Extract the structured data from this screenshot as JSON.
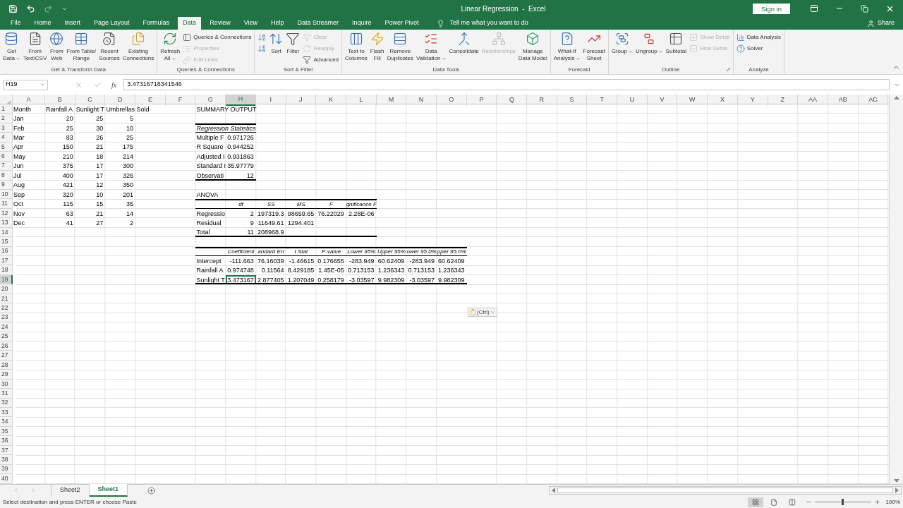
{
  "window": {
    "title": "Linear Regression  -  Excel",
    "sign_in": "Sign in"
  },
  "quick_access": [
    {
      "kind": "save",
      "disabled": false
    },
    {
      "kind": "undo",
      "disabled": false
    },
    {
      "kind": "redo",
      "disabled": true
    },
    {
      "kind": "customize",
      "disabled": false
    }
  ],
  "tabs": [
    {
      "label": "File",
      "selected": false
    },
    {
      "label": "Home",
      "selected": false
    },
    {
      "label": "Insert",
      "selected": false
    },
    {
      "label": "Page Layout",
      "selected": false
    },
    {
      "label": "Formulas",
      "selected": false
    },
    {
      "label": "Data",
      "selected": true
    },
    {
      "label": "Review",
      "selected": false
    },
    {
      "label": "View",
      "selected": false
    },
    {
      "label": "Help",
      "selected": false
    },
    {
      "label": "Data Streamer",
      "selected": false
    },
    {
      "label": "Inquire",
      "selected": false
    },
    {
      "label": "Power Pivot",
      "selected": false
    }
  ],
  "tell_me": "Tell me what you want to do",
  "share": "Share",
  "ribbon": {
    "groups": [
      {
        "label": "Get & Transform Data",
        "launcher": false,
        "items": [
          {
            "kind": "large",
            "lines": [
              "Get",
              "Data"
            ],
            "dropdown": true,
            "disabled": false
          },
          {
            "kind": "large",
            "lines": [
              "From",
              "Text/CSV"
            ],
            "dropdown": false,
            "disabled": false
          },
          {
            "kind": "large",
            "lines": [
              "From",
              "Web"
            ],
            "dropdown": false,
            "disabled": false
          },
          {
            "kind": "large",
            "lines": [
              "From Table/",
              "Range"
            ],
            "dropdown": false,
            "disabled": false
          },
          {
            "kind": "large",
            "lines": [
              "Recent",
              "Sources"
            ],
            "dropdown": false,
            "disabled": false
          },
          {
            "kind": "large",
            "lines": [
              "Existing",
              "Connections"
            ],
            "dropdown": false,
            "disabled": false
          }
        ]
      },
      {
        "label": "Queries & Connections",
        "launcher": false,
        "items": [
          {
            "kind": "large",
            "lines": [
              "Refresh",
              "All"
            ],
            "dropdown": true,
            "disabled": false
          },
          {
            "kind": "stack",
            "buttons": [
              {
                "label": "Queries & Connections",
                "disabled": false
              },
              {
                "label": "Properties",
                "disabled": true
              },
              {
                "label": "Edit Links",
                "disabled": true
              }
            ]
          }
        ]
      },
      {
        "label": "Sort & Filter",
        "launcher": false,
        "items": [
          {
            "kind": "stack",
            "buttons": [
              {
                "disabled": false
              },
              {
                "disabled": false
              }
            ]
          },
          {
            "kind": "large",
            "lines": [
              "Sort"
            ],
            "dropdown": false,
            "disabled": false
          },
          {
            "kind": "large",
            "lines": [
              "Filter"
            ],
            "dropdown": false,
            "disabled": false
          },
          {
            "kind": "stack",
            "buttons": [
              {
                "label": "Clear",
                "disabled": true
              },
              {
                "label": "Reapply",
                "disabled": true
              },
              {
                "label": "Advanced",
                "disabled": false
              }
            ]
          }
        ]
      },
      {
        "label": "Data Tools",
        "launcher": false,
        "items": [
          {
            "kind": "large",
            "lines": [
              "Text to",
              "Columns"
            ],
            "dropdown": false,
            "disabled": false
          },
          {
            "kind": "large",
            "lines": [
              "Flash",
              "Fill"
            ],
            "dropdown": false,
            "disabled": false
          },
          {
            "kind": "large",
            "lines": [
              "Remove",
              "Duplicates"
            ],
            "dropdown": false,
            "disabled": false
          },
          {
            "kind": "large",
            "lines": [
              "Data",
              "Validation"
            ],
            "dropdown": true,
            "disabled": false
          },
          {
            "kind": "large",
            "lines": [
              "Consolidate"
            ],
            "dropdown": false,
            "disabled": false
          },
          {
            "kind": "large",
            "lines": [
              "Relationships"
            ],
            "dropdown": false,
            "disabled": true
          },
          {
            "kind": "large",
            "lines": [
              "Manage",
              "Data Model"
            ],
            "dropdown": false,
            "disabled": false
          }
        ]
      },
      {
        "label": "Forecast",
        "launcher": false,
        "items": [
          {
            "kind": "large",
            "lines": [
              "What-If",
              "Analysis"
            ],
            "dropdown": true,
            "disabled": false
          },
          {
            "kind": "large",
            "lines": [
              "Forecast",
              "Sheet"
            ],
            "dropdown": false,
            "disabled": false
          }
        ]
      },
      {
        "label": "Outline",
        "launcher": true,
        "items": [
          {
            "kind": "large",
            "lines": [
              "Group"
            ],
            "dropdown": true,
            "disabled": false
          },
          {
            "kind": "large",
            "lines": [
              "Ungroup"
            ],
            "dropdown": true,
            "disabled": false
          },
          {
            "kind": "large",
            "lines": [
              "Subtotal"
            ],
            "dropdown": false,
            "disabled": false
          },
          {
            "kind": "stack",
            "buttons": [
              {
                "label": "Show Detail",
                "disabled": true
              },
              {
                "label": "Hide Detail",
                "disabled": true
              }
            ]
          }
        ]
      },
      {
        "label": "Analyze",
        "launcher": false,
        "items": [
          {
            "kind": "stack",
            "buttons": [
              {
                "label": "Data Analysis",
                "disabled": false
              },
              {
                "label": "Solver",
                "disabled": false
              }
            ]
          }
        ]
      }
    ]
  },
  "formula_bar": {
    "name_box": "H19",
    "fx": "fx",
    "value": "3.47316718341546"
  },
  "sheet": {
    "columns": [
      {
        "label": "A",
        "selected": false
      },
      {
        "label": "B",
        "selected": false
      },
      {
        "label": "C",
        "selected": false
      },
      {
        "label": "D",
        "selected": false
      },
      {
        "label": "E",
        "selected": false
      },
      {
        "label": "F",
        "selected": false
      },
      {
        "label": "G",
        "selected": false
      },
      {
        "label": "H",
        "selected": true
      },
      {
        "label": "I",
        "selected": false
      },
      {
        "label": "J",
        "selected": false
      },
      {
        "label": "K",
        "selected": false
      },
      {
        "label": "L",
        "selected": false
      },
      {
        "label": "M",
        "selected": false
      },
      {
        "label": "N",
        "selected": false
      },
      {
        "label": "O",
        "selected": false
      },
      {
        "label": "P",
        "selected": false
      },
      {
        "label": "Q",
        "selected": false
      },
      {
        "label": "R",
        "selected": false
      },
      {
        "label": "S",
        "selected": false
      },
      {
        "label": "T",
        "selected": false
      },
      {
        "label": "U",
        "selected": false
      },
      {
        "label": "V",
        "selected": false
      },
      {
        "label": "W",
        "selected": false
      },
      {
        "label": "X",
        "selected": false
      },
      {
        "label": "Y",
        "selected": false
      },
      {
        "label": "Z",
        "selected": false
      },
      {
        "label": "AA",
        "selected": false
      },
      {
        "label": "AB",
        "selected": false
      },
      {
        "label": "AC",
        "selected": false
      }
    ],
    "rows": [
      {
        "label": "1",
        "selected": false,
        "cells": [
          {
            "kind": "text",
            "text": "Month",
            "selected": false
          },
          {
            "kind": "text",
            "text": "Rainfall A",
            "selected": false
          },
          {
            "kind": "text",
            "text": "Sunlight T",
            "selected": false
          },
          {
            "kind": "text",
            "text": "Umbrellas Sold",
            "selected": false
          },
          {
            "kind": "empty",
            "selected": false
          },
          {
            "kind": "empty",
            "selected": false
          },
          {
            "kind": "text",
            "text": "SUMMARY OUTPUT",
            "selected": false
          }
        ]
      },
      {
        "label": "2",
        "selected": false,
        "cells": [
          {
            "kind": "text",
            "text": "Jan",
            "selected": false
          },
          {
            "kind": "number",
            "text": "20",
            "selected": false
          },
          {
            "kind": "number",
            "text": "25",
            "selected": false
          },
          {
            "kind": "number",
            "text": "5",
            "selected": false
          }
        ]
      },
      {
        "label": "3",
        "selected": false,
        "cells": [
          {
            "kind": "text",
            "text": "Feb",
            "selected": false
          },
          {
            "kind": "number",
            "text": "25",
            "selected": false
          },
          {
            "kind": "number",
            "text": "30",
            "selected": false
          },
          {
            "kind": "number",
            "text": "10",
            "selected": false
          },
          {
            "kind": "empty",
            "selected": false
          },
          {
            "kind": "empty",
            "selected": false
          },
          {
            "kind": "title",
            "text": "Regression Statistics",
            "selected": false,
            "thick_top": true,
            "thin_bottom": true
          },
          {
            "kind": "empty",
            "selected": false,
            "thick_top": true,
            "thin_bottom": true
          }
        ]
      },
      {
        "label": "4",
        "selected": false,
        "cells": [
          {
            "kind": "text",
            "text": "Mar",
            "selected": false
          },
          {
            "kind": "number",
            "text": "83",
            "selected": false
          },
          {
            "kind": "number",
            "text": "26",
            "selected": false
          },
          {
            "kind": "number",
            "text": "25",
            "selected": false
          },
          {
            "kind": "empty",
            "selected": false
          },
          {
            "kind": "empty",
            "selected": false
          },
          {
            "kind": "text",
            "text": "Multiple F",
            "selected": false
          },
          {
            "kind": "number",
            "text": "0.971726",
            "selected": false
          }
        ]
      },
      {
        "label": "5",
        "selected": false,
        "cells": [
          {
            "kind": "text",
            "text": "Apr",
            "selected": false
          },
          {
            "kind": "number",
            "text": "150",
            "selected": false
          },
          {
            "kind": "number",
            "text": "21",
            "selected": false
          },
          {
            "kind": "number",
            "text": "175",
            "selected": false
          },
          {
            "kind": "empty",
            "selected": false
          },
          {
            "kind": "empty",
            "selected": false
          },
          {
            "kind": "text",
            "text": "R Square",
            "selected": false
          },
          {
            "kind": "number",
            "text": "0.944252",
            "selected": false
          }
        ]
      },
      {
        "label": "6",
        "selected": false,
        "cells": [
          {
            "kind": "text",
            "text": "May",
            "selected": false
          },
          {
            "kind": "number",
            "text": "210",
            "selected": false
          },
          {
            "kind": "number",
            "text": "18",
            "selected": false
          },
          {
            "kind": "number",
            "text": "214",
            "selected": false
          },
          {
            "kind": "empty",
            "selected": false
          },
          {
            "kind": "empty",
            "selected": false
          },
          {
            "kind": "text",
            "text": "Adjusted I",
            "selected": false
          },
          {
            "kind": "number",
            "text": "0.931863",
            "selected": false
          }
        ]
      },
      {
        "label": "7",
        "selected": false,
        "cells": [
          {
            "kind": "text",
            "text": "Jun",
            "selected": false
          },
          {
            "kind": "number",
            "text": "375",
            "selected": false
          },
          {
            "kind": "number",
            "text": "17",
            "selected": false
          },
          {
            "kind": "number",
            "text": "300",
            "selected": false
          },
          {
            "kind": "empty",
            "selected": false
          },
          {
            "kind": "empty",
            "selected": false
          },
          {
            "kind": "text",
            "text": "Standard I",
            "selected": false
          },
          {
            "kind": "number",
            "text": "35.97779",
            "selected": false
          }
        ]
      },
      {
        "label": "8",
        "selected": false,
        "cells": [
          {
            "kind": "text",
            "text": "Jul",
            "selected": false
          },
          {
            "kind": "number",
            "text": "400",
            "selected": false
          },
          {
            "kind": "number",
            "text": "17",
            "selected": false
          },
          {
            "kind": "number",
            "text": "326",
            "selected": false
          },
          {
            "kind": "empty",
            "selected": false
          },
          {
            "kind": "empty",
            "selected": false
          },
          {
            "kind": "text",
            "text": "Observati",
            "selected": false,
            "thick_bottom": true
          },
          {
            "kind": "number",
            "text": "12",
            "selected": false,
            "thick_bottom": true
          }
        ]
      },
      {
        "label": "9",
        "selected": false,
        "cells": [
          {
            "kind": "text",
            "text": "Aug",
            "selected": false
          },
          {
            "kind": "number",
            "text": "421",
            "selected": false
          },
          {
            "kind": "number",
            "text": "12",
            "selected": false
          },
          {
            "kind": "number",
            "text": "350",
            "selected": false
          }
        ]
      },
      {
        "label": "10",
        "selected": false,
        "cells": [
          {
            "kind": "text",
            "text": "Sep",
            "selected": false
          },
          {
            "kind": "number",
            "text": "320",
            "selected": false
          },
          {
            "kind": "number",
            "text": "10",
            "selected": false
          },
          {
            "kind": "number",
            "text": "201",
            "selected": false
          },
          {
            "kind": "empty",
            "selected": false
          },
          {
            "kind": "empty",
            "selected": false
          },
          {
            "kind": "text",
            "text": "ANOVA",
            "selected": false
          }
        ]
      },
      {
        "label": "11",
        "selected": false,
        "cells": [
          {
            "kind": "text",
            "text": "Oct",
            "selected": false
          },
          {
            "kind": "number",
            "text": "115",
            "selected": false
          },
          {
            "kind": "number",
            "text": "15",
            "selected": false
          },
          {
            "kind": "number",
            "text": "35",
            "selected": false
          },
          {
            "kind": "empty",
            "selected": false
          },
          {
            "kind": "empty",
            "selected": false
          },
          {
            "kind": "empty",
            "selected": false,
            "thick_top": true,
            "thin_bottom": true
          },
          {
            "kind": "header",
            "text": "df",
            "selected": false,
            "thick_top": true,
            "thin_bottom": true
          },
          {
            "kind": "header",
            "text": "SS",
            "selected": false,
            "thick_top": true,
            "thin_bottom": true
          },
          {
            "kind": "header",
            "text": "MS",
            "selected": false,
            "thick_top": true,
            "thin_bottom": true
          },
          {
            "kind": "header",
            "text": "F",
            "selected": false,
            "thick_top": true,
            "thin_bottom": true
          },
          {
            "kind": "header",
            "text": "gnificance F",
            "selected": false,
            "thick_top": true,
            "thin_bottom": true
          }
        ]
      },
      {
        "label": "12",
        "selected": false,
        "cells": [
          {
            "kind": "text",
            "text": "Nov",
            "selected": false
          },
          {
            "kind": "number",
            "text": "63",
            "selected": false
          },
          {
            "kind": "number",
            "text": "21",
            "selected": false
          },
          {
            "kind": "number",
            "text": "14",
            "selected": false
          },
          {
            "kind": "empty",
            "selected": false
          },
          {
            "kind": "empty",
            "selected": false
          },
          {
            "kind": "text",
            "text": "Regressio",
            "selected": false
          },
          {
            "kind": "number",
            "text": "2",
            "selected": false
          },
          {
            "kind": "number",
            "text": "197319.3",
            "selected": false
          },
          {
            "kind": "number",
            "text": "98659.65",
            "selected": false
          },
          {
            "kind": "number",
            "text": "76.22029",
            "selected": false
          },
          {
            "kind": "number",
            "text": "2.28E-06",
            "selected": false
          }
        ]
      },
      {
        "label": "13",
        "selected": false,
        "cells": [
          {
            "kind": "text",
            "text": "Dec",
            "selected": false
          },
          {
            "kind": "number",
            "text": "41",
            "selected": false
          },
          {
            "kind": "number",
            "text": "27",
            "selected": false
          },
          {
            "kind": "number",
            "text": "2",
            "selected": false
          },
          {
            "kind": "empty",
            "selected": false
          },
          {
            "kind": "empty",
            "selected": false
          },
          {
            "kind": "text",
            "text": "Residual",
            "selected": false
          },
          {
            "kind": "number",
            "text": "9",
            "selected": false
          },
          {
            "kind": "number",
            "text": "11649.61",
            "selected": false
          },
          {
            "kind": "number",
            "text": "1294.401",
            "selected": false
          }
        ]
      },
      {
        "label": "14",
        "selected": false,
        "cells": [
          {
            "kind": "empty",
            "selected": false
          },
          {
            "kind": "empty",
            "selected": false
          },
          {
            "kind": "empty",
            "selected": false
          },
          {
            "kind": "empty",
            "selected": false
          },
          {
            "kind": "empty",
            "selected": false
          },
          {
            "kind": "empty",
            "selected": false
          },
          {
            "kind": "text",
            "text": "Total",
            "selected": false,
            "thick_bottom": true
          },
          {
            "kind": "number",
            "text": "11",
            "selected": false,
            "thick_bottom": true
          },
          {
            "kind": "number",
            "text": "208968.9",
            "selected": false,
            "thick_bottom": true
          },
          {
            "kind": "empty",
            "selected": false,
            "thick_bottom": true
          },
          {
            "kind": "empty",
            "selected": false,
            "thick_bottom": true
          },
          {
            "kind": "empty",
            "selected": false,
            "thick_bottom": true
          }
        ]
      },
      {
        "label": "15",
        "selected": false
      },
      {
        "label": "16",
        "selected": false,
        "cells": [
          {
            "kind": "empty",
            "selected": false
          },
          {
            "kind": "empty",
            "selected": false
          },
          {
            "kind": "empty",
            "selected": false
          },
          {
            "kind": "empty",
            "selected": false
          },
          {
            "kind": "empty",
            "selected": false
          },
          {
            "kind": "empty",
            "selected": false
          },
          {
            "kind": "empty",
            "selected": false,
            "thick_top": true,
            "thin_bottom": true
          },
          {
            "kind": "header",
            "text": "Coefficient",
            "selected": false,
            "thick_top": true,
            "thin_bottom": true
          },
          {
            "kind": "header",
            "text": "andard Err",
            "selected": false,
            "thick_top": true,
            "thin_bottom": true
          },
          {
            "kind": "header",
            "text": "t Stat",
            "selected": false,
            "thick_top": true,
            "thin_bottom": true
          },
          {
            "kind": "header",
            "text": "P-value",
            "selected": false,
            "thick_top": true,
            "thin_bottom": true
          },
          {
            "kind": "header",
            "text": "Lower 95%",
            "selected": false,
            "thick_top": true,
            "thin_bottom": true
          },
          {
            "kind": "header",
            "text": "Upper 95%",
            "selected": false,
            "thick_top": true,
            "thin_bottom": true
          },
          {
            "kind": "header",
            "text": "ower 95.0%",
            "selected": false,
            "thick_top": true,
            "thin_bottom": true
          },
          {
            "kind": "header",
            "text": "pper 95.0%",
            "selected": false,
            "thick_top": true,
            "thin_bottom": true
          }
        ]
      },
      {
        "label": "17",
        "selected": false,
        "cells": [
          {
            "kind": "empty",
            "selected": false
          },
          {
            "kind": "empty",
            "selected": false
          },
          {
            "kind": "empty",
            "selected": false
          },
          {
            "kind": "empty",
            "selected": false
          },
          {
            "kind": "empty",
            "selected": false
          },
          {
            "kind": "empty",
            "selected": false
          },
          {
            "kind": "text",
            "text": "Intercept",
            "selected": false
          },
          {
            "kind": "number",
            "text": "-111.663",
            "selected": false
          },
          {
            "kind": "number",
            "text": "76.16039",
            "selected": false
          },
          {
            "kind": "number",
            "text": "-1.46615",
            "selected": false
          },
          {
            "kind": "number",
            "text": "0.176655",
            "selected": false
          },
          {
            "kind": "number",
            "text": "-283.949",
            "selected": false
          },
          {
            "kind": "number",
            "text": "60.62409",
            "selected": false
          },
          {
            "kind": "number",
            "text": "-283.949",
            "selected": false
          },
          {
            "kind": "number",
            "text": "60.62409",
            "selected": false
          }
        ]
      },
      {
        "label": "18",
        "selected": false,
        "cells": [
          {
            "kind": "empty",
            "selected": false
          },
          {
            "kind": "empty",
            "selected": false
          },
          {
            "kind": "empty",
            "selected": false
          },
          {
            "kind": "empty",
            "selected": false
          },
          {
            "kind": "empty",
            "selected": false
          },
          {
            "kind": "empty",
            "selected": false
          },
          {
            "kind": "text",
            "text": "Rainfall A",
            "selected": false
          },
          {
            "kind": "number",
            "text": "0.974748",
            "selected": false
          },
          {
            "kind": "number",
            "text": "0.11564",
            "selected": false
          },
          {
            "kind": "number",
            "text": "8.429185",
            "selected": false
          },
          {
            "kind": "number",
            "text": "1.45E-05",
            "selected": false
          },
          {
            "kind": "number",
            "text": "0.713153",
            "selected": false
          },
          {
            "kind": "number",
            "text": "1.236343",
            "selected": false
          },
          {
            "kind": "number",
            "text": "0.713153",
            "selected": false
          },
          {
            "kind": "number",
            "text": "1.236343",
            "selected": false
          }
        ]
      },
      {
        "label": "19",
        "selected": true,
        "cells": [
          {
            "kind": "empty",
            "selected": false
          },
          {
            "kind": "empty",
            "selected": false
          },
          {
            "kind": "empty",
            "selected": false
          },
          {
            "kind": "empty",
            "selected": false
          },
          {
            "kind": "empty",
            "selected": false
          },
          {
            "kind": "empty",
            "selected": false
          },
          {
            "kind": "text",
            "text": "Sunlight T",
            "selected": false,
            "thick_bottom": true
          },
          {
            "kind": "number",
            "text": "3.473167",
            "selected": true,
            "thick_bottom": true
          },
          {
            "kind": "number",
            "text": "2.877405",
            "selected": false,
            "thick_bottom": true
          },
          {
            "kind": "number",
            "text": "1.207049",
            "selected": false,
            "thick_bottom": true
          },
          {
            "kind": "number",
            "text": "0.258179",
            "selected": false,
            "thick_bottom": true
          },
          {
            "kind": "number",
            "text": "-3.03597",
            "selected": false,
            "thick_bottom": true
          },
          {
            "kind": "number",
            "text": "9.982309",
            "selected": false,
            "thick_bottom": true
          },
          {
            "kind": "number",
            "text": "-3.03597",
            "selected": false,
            "thick_bottom": true
          },
          {
            "kind": "number",
            "text": "9.982309",
            "selected": false,
            "thick_bottom": true
          }
        ]
      },
      {
        "label": "20",
        "selected": false
      },
      {
        "label": "21",
        "selected": false
      },
      {
        "label": "22",
        "selected": false
      },
      {
        "label": "23",
        "selected": false
      },
      {
        "label": "24",
        "selected": false
      },
      {
        "label": "25",
        "selected": false
      },
      {
        "label": "26",
        "selected": false
      },
      {
        "label": "27",
        "selected": false
      },
      {
        "label": "28",
        "selected": false
      },
      {
        "label": "29",
        "selected": false
      },
      {
        "label": "30",
        "selected": false
      },
      {
        "label": "31",
        "selected": false
      },
      {
        "label": "32",
        "selected": false
      },
      {
        "label": "33",
        "selected": false
      },
      {
        "label": "34",
        "selected": false
      },
      {
        "label": "35",
        "selected": false
      },
      {
        "label": "36",
        "selected": false
      },
      {
        "label": "37",
        "selected": false
      },
      {
        "label": "38",
        "selected": false
      },
      {
        "label": "39",
        "selected": false
      },
      {
        "label": "40",
        "selected": false
      }
    ]
  },
  "paste_options": {
    "label": "(Ctrl)"
  },
  "sheet_tabs": [
    {
      "label": "Sheet2",
      "selected": false
    },
    {
      "label": "Sheet1",
      "selected": true
    }
  ],
  "status_bar": {
    "message": "Select destination and press ENTER or choose Paste",
    "views": [
      {
        "kind": "normal",
        "selected": true
      },
      {
        "kind": "page_layout",
        "selected": false
      },
      {
        "kind": "page_break",
        "selected": false
      }
    ],
    "zoom": {
      "level": 0.5,
      "reading": "100%"
    }
  }
}
